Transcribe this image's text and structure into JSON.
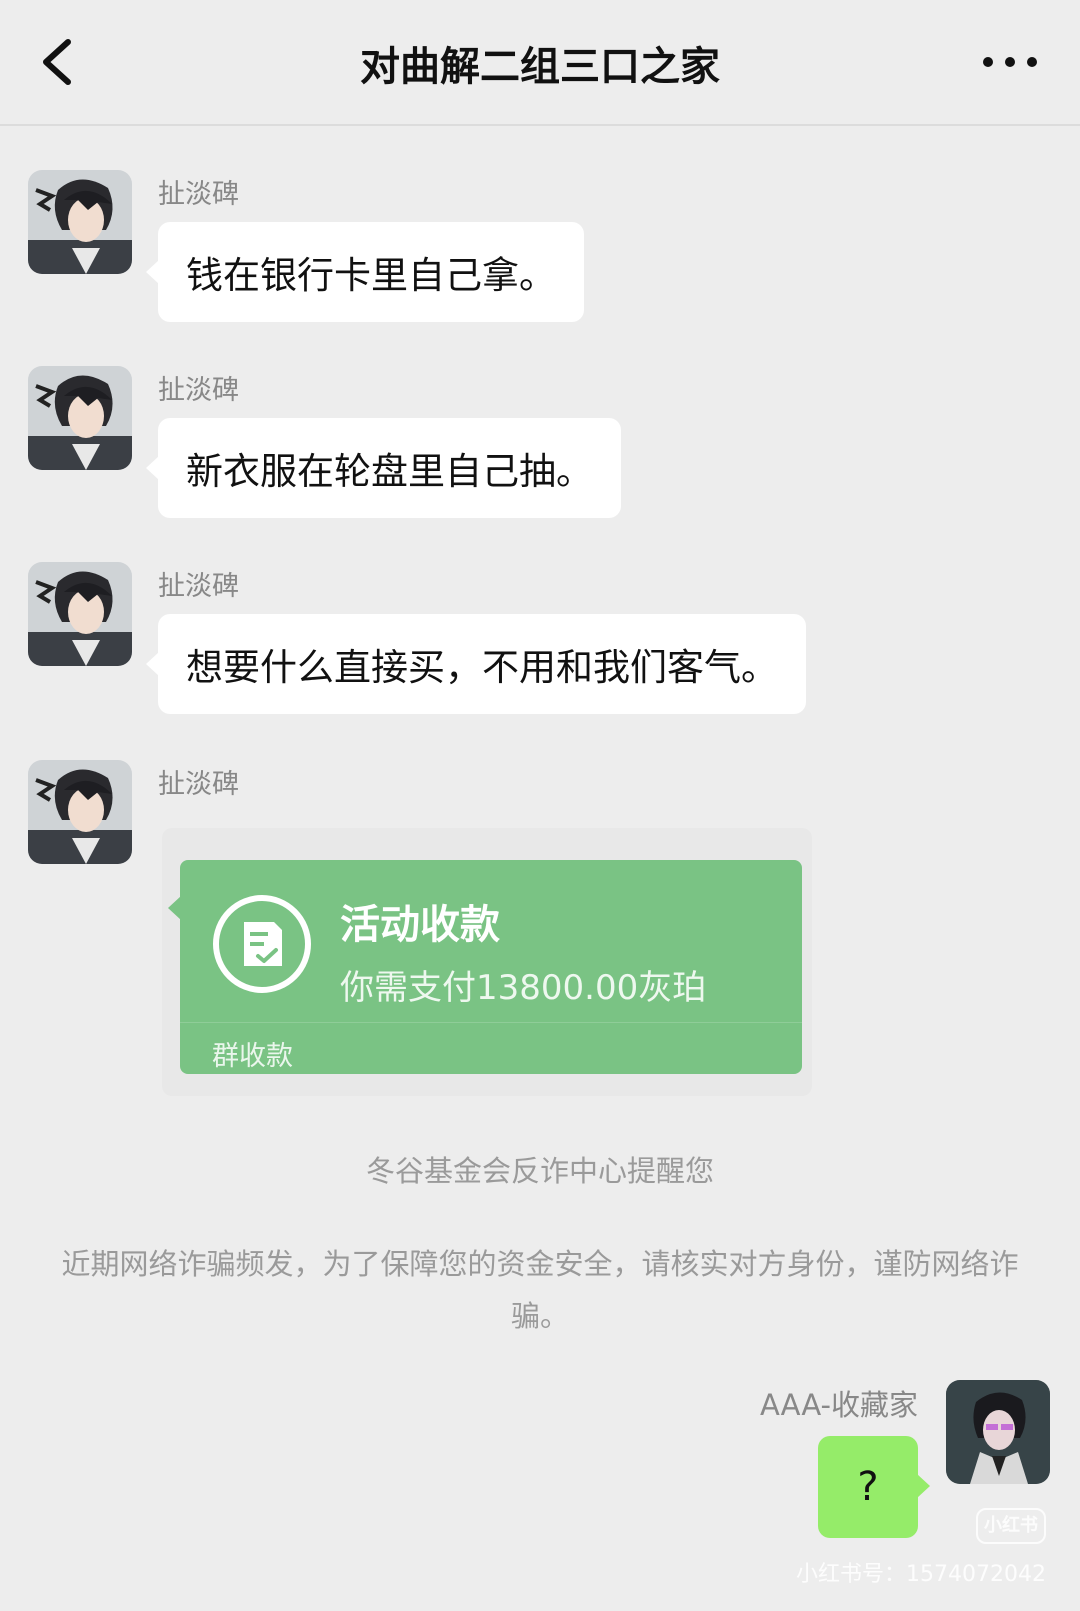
{
  "header": {
    "title": "对曲解二组三口之家"
  },
  "messages": [
    {
      "sender": "扯淡碑",
      "text": "钱在银行卡里自己拿。"
    },
    {
      "sender": "扯淡碑",
      "text": "新衣服在轮盘里自己抽。"
    },
    {
      "sender": "扯淡碑",
      "text": "想要什么直接买，不用和我们客气。"
    },
    {
      "sender": "扯淡碑"
    }
  ],
  "payment": {
    "title": "活动收款",
    "amount_text": "你需支付13800.00灰珀",
    "footer": "群收款",
    "accent_color": "#7ac384"
  },
  "notice": {
    "title": "冬谷基金会反诈中心提醒您",
    "body": "近期网络诈骗频发，为了保障您的资金安全，请核实对方身份，谨防网络诈骗。"
  },
  "my_message": {
    "sender": "AAA-收藏家",
    "text": "?",
    "bubble_color": "#95ec69"
  },
  "watermark": {
    "logo": "小红书",
    "id_text": "小红书号：1574072042"
  }
}
